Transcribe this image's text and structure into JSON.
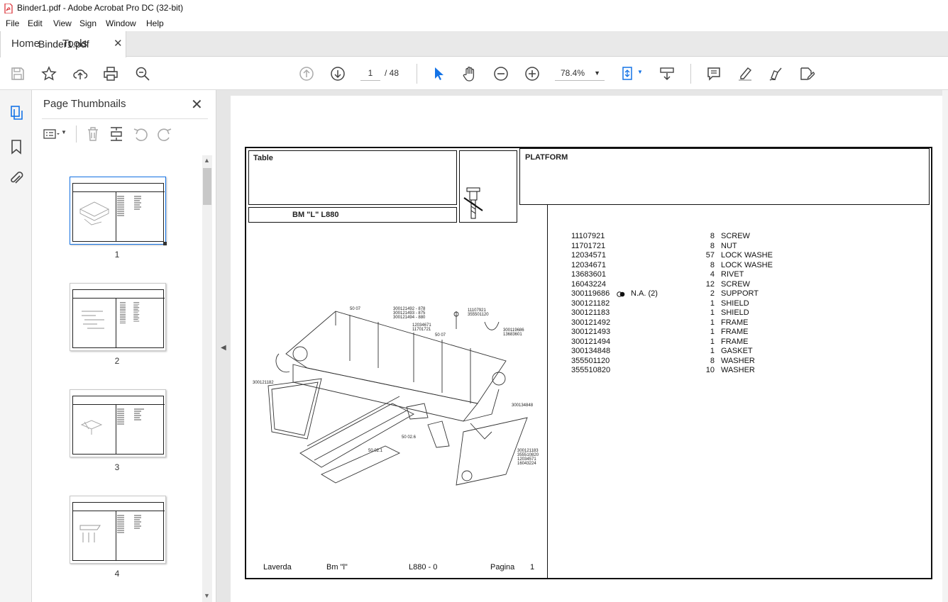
{
  "window": {
    "title": "Binder1.pdf - Adobe Acrobat Pro DC (32-bit)"
  },
  "menu": [
    "File",
    "Edit",
    "View",
    "Sign",
    "Window",
    "Help"
  ],
  "tabs": {
    "home": "Home",
    "tools": "Tools",
    "document": "Binder1.pdf"
  },
  "toolbar": {
    "current_page": "1",
    "page_total": "/ 48",
    "zoom": "78.4%"
  },
  "thumbnails": {
    "title": "Page Thumbnails",
    "pages": [
      "1",
      "2",
      "3",
      "4"
    ]
  },
  "document": {
    "table_label": "Table",
    "platform_label": "PLATFORM",
    "model_label": "BM \"L\"  L880",
    "parts": [
      {
        "number": "11107921",
        "qty": "8",
        "desc": "SCREW",
        "note": ""
      },
      {
        "number": "11701721",
        "qty": "8",
        "desc": "NUT",
        "note": ""
      },
      {
        "number": "12034571",
        "qty": "57",
        "desc": "LOCK WASHE",
        "note": ""
      },
      {
        "number": "12034671",
        "qty": "8",
        "desc": "LOCK WASHE",
        "note": ""
      },
      {
        "number": "13683601",
        "qty": "4",
        "desc": "RIVET",
        "note": ""
      },
      {
        "number": "16043224",
        "qty": "12",
        "desc": "SCREW",
        "note": ""
      },
      {
        "number": "300119686",
        "qty": "2",
        "desc": "SUPPORT",
        "note": "N.A.  (2)"
      },
      {
        "number": "300121182",
        "qty": "1",
        "desc": "SHIELD",
        "note": ""
      },
      {
        "number": "300121183",
        "qty": "1",
        "desc": "SHIELD",
        "note": ""
      },
      {
        "number": "300121492",
        "qty": "1",
        "desc": "FRAME",
        "note": ""
      },
      {
        "number": "300121493",
        "qty": "1",
        "desc": "FRAME",
        "note": ""
      },
      {
        "number": "300121494",
        "qty": "1",
        "desc": "FRAME",
        "note": ""
      },
      {
        "number": "300134848",
        "qty": "1",
        "desc": "GASKET",
        "note": ""
      },
      {
        "number": "355501120",
        "qty": "8",
        "desc": "WASHER",
        "note": ""
      },
      {
        "number": "355510820",
        "qty": "10",
        "desc": "WASHER",
        "note": ""
      }
    ],
    "footer": {
      "brand": "Laverda",
      "model": "Bm \"l\"",
      "code": "L880 - 0",
      "page_label": "Pagina",
      "page_num": "1"
    },
    "callouts": {
      "c1": "300121492 - 878",
      "c2": "300121493 - 875",
      "c3": "300121494 - 880",
      "c4": "11107921",
      "c5": "355501120",
      "c6": "12034671",
      "c7": "11701721",
      "c8": "300119686",
      "c9": "13683601",
      "c10": "300121182",
      "c11": "300134848",
      "c12": "300121183",
      "c13": "355510820",
      "c14": "12034571",
      "c15": "16043224",
      "r1": "50 07",
      "r2": "50 07",
      "r3": "50 02.1",
      "r4": "50 02.6"
    }
  },
  "colors": {
    "accent": "#1473e6",
    "pdf_red": "#d8292f"
  }
}
